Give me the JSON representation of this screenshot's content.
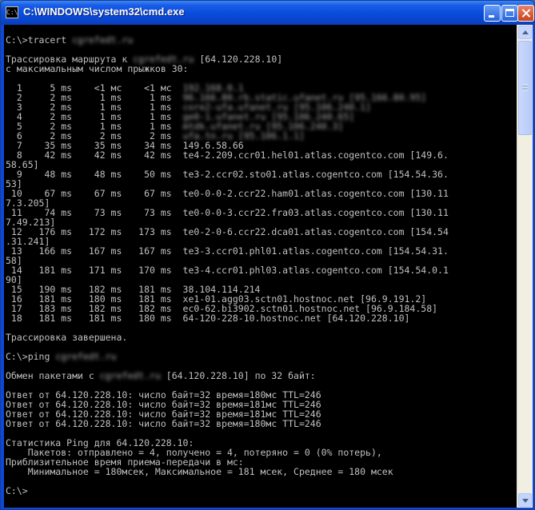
{
  "window": {
    "title": "C:\\WINDOWS\\system32\\cmd.exe",
    "icon_text": "C:\\",
    "icon": "console-window-icon"
  },
  "colors": {
    "titlebar": "#0a4ddc",
    "console_bg": "#000000",
    "console_fg": "#c0c0c0",
    "close_button": "#c8421d"
  },
  "console": {
    "lines": [
      {
        "text": "C:\\>tracert ",
        "redacted": "cgrefedt.ru"
      },
      {
        "text": "",
        "redacted": ""
      },
      {
        "text": "Трассировка маршрута к ",
        "redacted": "cgrefedt.ru",
        "suffix": " [64.120.228.10]"
      },
      {
        "text": "с максимальным числом прыжков 30:",
        "redacted": ""
      },
      {
        "text": "",
        "redacted": ""
      },
      {
        "text": "  1     5 ms    <1 мс    <1 мс  ",
        "redacted": "192.168.0.1"
      },
      {
        "text": "  2     2 ms     1 ms     1 ms  ",
        "redacted": "96.166.80.rb.static.ufanet.ru [95.166.80.95]"
      },
      {
        "text": "  3     2 ms     1 ms     1 ms  ",
        "redacted": "core2-ufa.ufanet.ru [95.106.240.1]"
      },
      {
        "text": "  4     2 ms     1 ms     1 ms  ",
        "redacted": "ge0-1.ufanet.ru [95.106.240.65]"
      },
      {
        "text": "  5     2 ms     1 ms     1 ms  ",
        "redacted": "mtdk.ufanet.ru [95.106.240.3]"
      },
      {
        "text": "  6     2 ms     2 ms     2 ms  ",
        "redacted": "ufa.tn.ru [95.106.1.1]"
      },
      {
        "text": "  7    35 ms    35 ms    34 ms  149.6.58.66",
        "redacted": ""
      },
      {
        "text": "  8    42 ms    42 ms    42 ms  te4-2.209.ccr01.hel01.atlas.cogentco.com [149.6.",
        "redacted": ""
      },
      {
        "text": "58.65]",
        "redacted": ""
      },
      {
        "text": "  9    48 ms    48 ms    50 ms  te3-2.ccr02.sto01.atlas.cogentco.com [154.54.36.",
        "redacted": ""
      },
      {
        "text": "53]",
        "redacted": ""
      },
      {
        "text": " 10    67 ms    67 ms    67 ms  te0-0-0-2.ccr22.ham01.atlas.cogentco.com [130.11",
        "redacted": ""
      },
      {
        "text": "7.3.205]",
        "redacted": ""
      },
      {
        "text": " 11    74 ms    73 ms    73 ms  te0-0-0-3.ccr22.fra03.atlas.cogentco.com [130.11",
        "redacted": ""
      },
      {
        "text": "7.49.213]",
        "redacted": ""
      },
      {
        "text": " 12   176 ms   172 ms   173 ms  te0-2-0-6.ccr22.dca01.atlas.cogentco.com [154.54",
        "redacted": ""
      },
      {
        "text": ".31.241]",
        "redacted": ""
      },
      {
        "text": " 13   166 ms   167 ms   167 ms  te3-3.ccr01.phl01.atlas.cogentco.com [154.54.31.",
        "redacted": ""
      },
      {
        "text": "58]",
        "redacted": ""
      },
      {
        "text": " 14   181 ms   171 ms   170 ms  te3-4.ccr01.phl03.atlas.cogentco.com [154.54.0.1",
        "redacted": ""
      },
      {
        "text": "90]",
        "redacted": ""
      },
      {
        "text": " 15   190 ms   182 ms   181 ms  38.104.114.214",
        "redacted": ""
      },
      {
        "text": " 16   181 ms   180 ms   181 ms  xe1-01.agg03.sctn01.hostnoc.net [96.9.191.2]",
        "redacted": ""
      },
      {
        "text": " 17   183 ms   182 ms   182 ms  ec0-62.bi3902.sctn01.hostnoc.net [96.9.184.58]",
        "redacted": ""
      },
      {
        "text": " 18   181 ms   181 ms   180 ms  64-120-228-10.hostnoc.net [64.120.228.10]",
        "redacted": ""
      },
      {
        "text": "",
        "redacted": ""
      },
      {
        "text": "Трассировка завершена.",
        "redacted": ""
      },
      {
        "text": "",
        "redacted": ""
      },
      {
        "text": "C:\\>ping ",
        "redacted": "cgrefedt.ru"
      },
      {
        "text": "",
        "redacted": ""
      },
      {
        "text": "Обмен пакетами с ",
        "redacted": "cgrefedt.ru",
        "suffix": " [64.120.228.10] по 32 байт:"
      },
      {
        "text": "",
        "redacted": ""
      },
      {
        "text": "Ответ от 64.120.228.10: число байт=32 время=180мс TTL=246",
        "redacted": ""
      },
      {
        "text": "Ответ от 64.120.228.10: число байт=32 время=181мс TTL=246",
        "redacted": ""
      },
      {
        "text": "Ответ от 64.120.228.10: число байт=32 время=181мс TTL=246",
        "redacted": ""
      },
      {
        "text": "Ответ от 64.120.228.10: число байт=32 время=180мс TTL=246",
        "redacted": ""
      },
      {
        "text": "",
        "redacted": ""
      },
      {
        "text": "Статистика Ping для 64.120.228.10:",
        "redacted": ""
      },
      {
        "text": "    Пакетов: отправлено = 4, получено = 4, потеряно = 0 (0% потерь),",
        "redacted": ""
      },
      {
        "text": "Приблизительное время приема-передачи в мс:",
        "redacted": ""
      },
      {
        "text": "    Минимальное = 180мсек, Максимальное = 181 мсек, Среднее = 180 мсек",
        "redacted": ""
      },
      {
        "text": "",
        "redacted": ""
      },
      {
        "text": "C:\\>",
        "redacted": ""
      }
    ]
  },
  "scrollbar": {
    "up_icon": "scroll-up-arrow-icon",
    "down_icon": "scroll-down-arrow-icon",
    "thumb_position": 0.05
  }
}
